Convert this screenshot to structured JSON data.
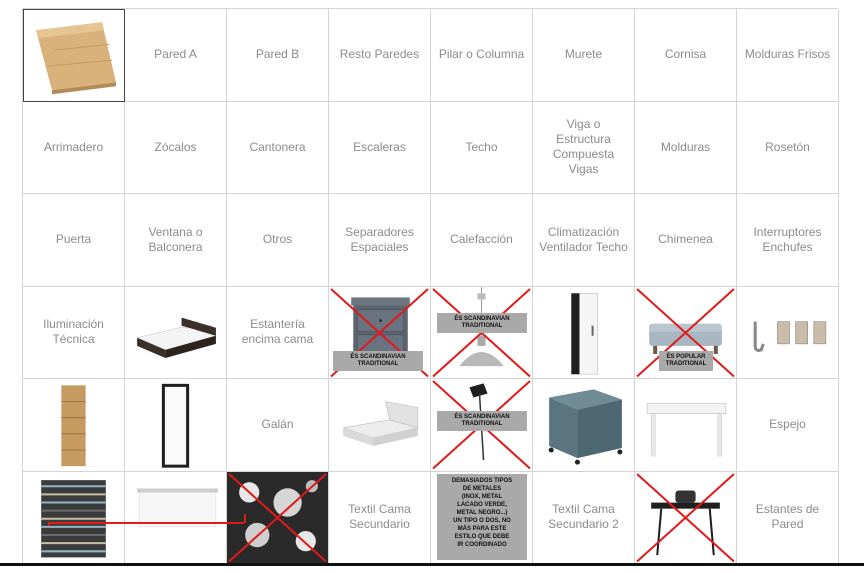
{
  "grid": {
    "row1": [
      "Pared A",
      "Pared B",
      "Resto Paredes",
      "Pilar o Columna",
      "Murete",
      "Cornisa",
      "Molduras Frisos"
    ],
    "row2": [
      "Arrimadero",
      "Zócalos",
      "Cantonera",
      "Escaleras",
      "Techo",
      "Viga o\nEstructura\nCompuesta\nVigas",
      "Molduras",
      "Rosetón"
    ],
    "row3": [
      "Puerta",
      "Ventana o\nBalconera",
      "Otros",
      "Separadores\nEspaciales",
      "Calefacción",
      "Climatización\nVentilador Techo",
      "Chimenea",
      "Interruptores\nEnchufes"
    ],
    "row4": {
      "c1": "Iluminación\nTécnica",
      "c3": "Estantería\nencima cama"
    },
    "row5": {
      "c3": "Galán",
      "c8": "Espejo"
    },
    "row6": {
      "c4": "Textil Cama\nSecundario",
      "c6": "Textil Cama\nSecundario 2",
      "c8": "Estantes de\nPared"
    }
  },
  "notes": {
    "nightstand": "ÉS SCANDINAVIAN\nTRADITIONAL",
    "pendant_lamp": "ÉS SCANDINAVIAN\nTRADITIONAL",
    "bench": "ÉS POPULAR\nTRADITIONAL",
    "desk_lamp": "ÉS SCANDINAVIAN\nTRADITIONAL",
    "metals": "DEMASIADOS TIPOS\nDE METALES\n(INOX, METAL\nLACADO VERDE,\nMETAL NEGRO...)\nUN  TIPO O DOS, NO\nMÁS PARA ESTE\nESTILO QUE DEBE\nIR COORDINADO"
  },
  "colors": {
    "cross": "#e11a1a",
    "note_bg": "#a9a9a9",
    "text": "#8c8c8c",
    "grid": "#d4d4d4"
  }
}
